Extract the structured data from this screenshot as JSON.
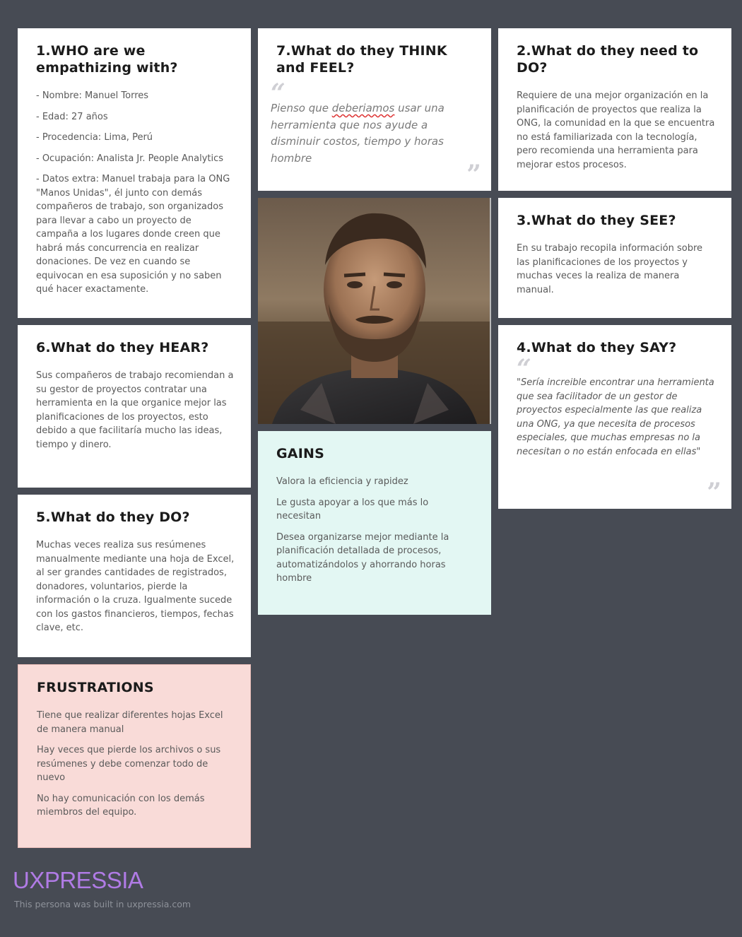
{
  "cards": {
    "who": {
      "title": "1.WHO are we empathizing with?",
      "items": [
        "- Nombre: Manuel Torres",
        "- Edad: 27 años",
        "- Procedencia: Lima, Perú",
        "- Ocupación: Analista Jr. People Analytics",
        "- Datos extra: Manuel trabaja para la ONG \"Manos Unidas\", él junto con demás compañeros de trabajo, son organizados para llevar a cabo un proyecto de campaña a los lugares donde creen que habrá más concurrencia en realizar donaciones. De vez en cuando se equivocan en esa suposición y no saben qué hacer exactamente."
      ]
    },
    "think": {
      "title": "7.What do they THINK and FEEL?",
      "quote_before": "Pienso que ",
      "quote_misspelled": "deberiamos",
      "quote_after": " usar una herramienta que nos ayude a disminuir costos, tiempo y horas hombre"
    },
    "need": {
      "title": "2.What do they need to DO?",
      "text": "Requiere de una mejor organización en la planificación de proyectos que realiza la ONG, la comunidad en la que se encuentra no está familiarizada con la tecnología, pero recomienda una herramienta para mejorar estos procesos."
    },
    "see": {
      "title": "3.What do they SEE?",
      "text": "En su trabajo recopila información sobre las planificaciones de los proyectos y muchas veces la realiza de manera manual."
    },
    "hear": {
      "title": "6.What do they HEAR?",
      "text": "Sus compañeros de trabajo recomiendan a su gestor de proyectos contratar una herramienta en la que organice mejor las planificaciones de los proyectos, esto debido a que facilitaría mucho las ideas, tiempo y dinero."
    },
    "say": {
      "title": "4.What do they SAY?",
      "text": "\"Sería increible encontrar una herramienta que sea facilitador de un gestor de proyectos especialmente las que realiza una ONG, ya que necesita de procesos especiales, que muchas empresas no la necesitan o no están enfocada en ellas\""
    },
    "do": {
      "title": "5.What do they DO?",
      "text": "Muchas veces realiza sus resúmenes manualmente mediante una hoja de Excel, al ser grandes cantidades de registrados, donadores, voluntarios, pierde la información o la cruza. Igualmente sucede con los gastos financieros, tiempos, fechas clave, etc."
    },
    "gains": {
      "title": "GAINS",
      "items": [
        "Valora la eficiencia y rapidez",
        "Le gusta apoyar a los que más lo necesitan",
        "Desea organizarse mejor mediante la planificación detallada de procesos, automatizándolos y ahorrando horas hombre"
      ]
    },
    "frustrations": {
      "title": "FRUSTRATIONS",
      "items": [
        "Tiene que realizar diferentes hojas Excel de manera manual",
        "Hay veces que pierde los archivos o sus resúmenes y debe comenzar todo de nuevo",
        "No hay comunicación con los demás miembros del equipo."
      ]
    }
  },
  "quote_marks": {
    "open": "“",
    "close": "”"
  },
  "footer": {
    "brand": "UXPRESSIA",
    "note": "This persona was built in uxpressia.com"
  },
  "colors": {
    "background": "#474b54",
    "gains_bg": "#e3f7f3",
    "frustrations_bg": "#f9dbd8",
    "brand": "#b07be5"
  }
}
